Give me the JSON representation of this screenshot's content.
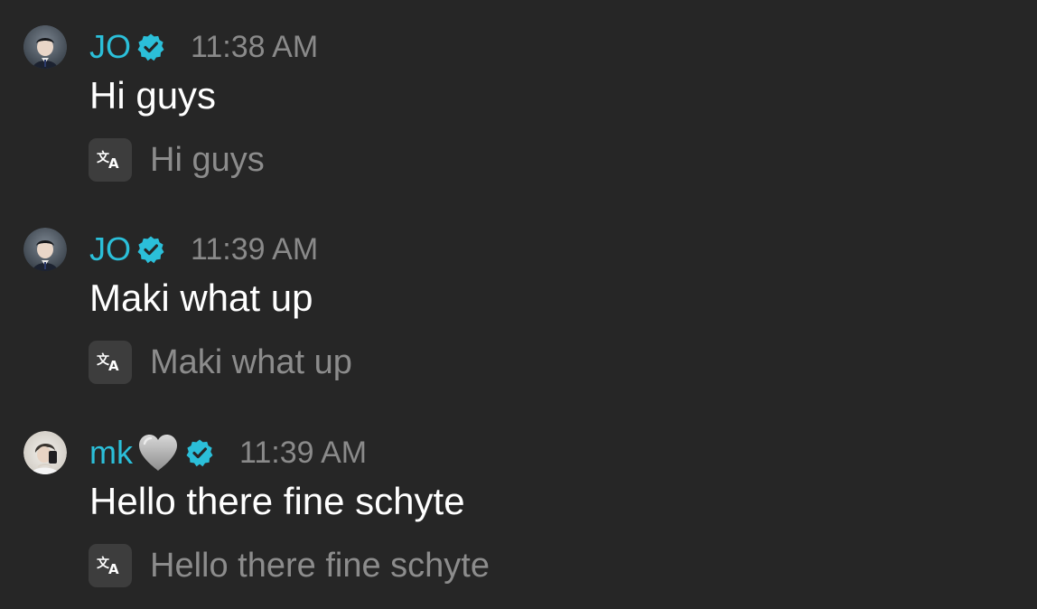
{
  "messages": [
    {
      "username": "JO",
      "verified": true,
      "timestamp": "11:38 AM",
      "text": "Hi guys",
      "translation": "Hi guys"
    },
    {
      "username": "JO",
      "verified": true,
      "timestamp": "11:39 AM",
      "text": "Maki what up",
      "translation": "Maki what up"
    },
    {
      "username": "mk",
      "username_emoji": "grey-heart",
      "verified": true,
      "timestamp": "11:39 AM",
      "text": "Hello there fine schyte",
      "translation": "Hello there fine schyte"
    }
  ],
  "colors": {
    "background": "#262626",
    "username": "#2bbfd9",
    "verified_badge": "#2bbfd9",
    "timestamp": "#8a8a8a",
    "message_text": "#ffffff",
    "translation_text": "#8c8c8c",
    "translate_icon_bg": "#3d3d3d"
  },
  "icons": {
    "verified": "verified-badge-icon",
    "translate": "translate-icon",
    "heart": "grey-heart-icon"
  }
}
